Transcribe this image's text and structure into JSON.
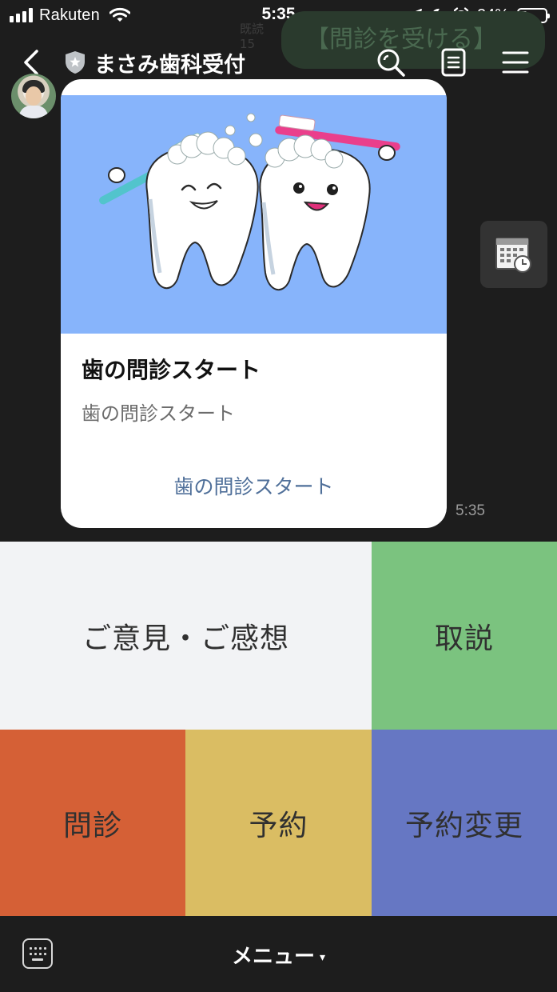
{
  "status_bar": {
    "carrier": "Rakuten",
    "time": "5:35",
    "battery_percent": "24%",
    "battery_level": 0.24,
    "signal_bars": 4
  },
  "background": {
    "sender_fragment": "既読\n15",
    "bubble_text": "【問診を受ける】"
  },
  "header": {
    "title": "まさみ歯科受付",
    "icons": [
      "back-chevron",
      "verified-shield",
      "search",
      "notes",
      "menu"
    ]
  },
  "message": {
    "card": {
      "title": "歯の問診スタート",
      "subtitle": "歯の問診スタート",
      "action_label": "歯の問診スタート",
      "image_bg_color": "#87b4fb"
    },
    "time": "5:35"
  },
  "side_button": {
    "icon": "calendar-clock"
  },
  "rich_menu": {
    "tiles": [
      {
        "label": "ご意見・ご感想",
        "color": "#f2f3f5"
      },
      {
        "label": "取説",
        "color": "#7bc37f"
      },
      {
        "label": "問診",
        "color": "#d56036"
      },
      {
        "label": "予約",
        "color": "#dabd63"
      },
      {
        "label": "予約変更",
        "color": "#6677c3"
      }
    ]
  },
  "bottom_bar": {
    "menu_label": "メニュー",
    "caret": "▾"
  },
  "colors": {
    "background": "#1d1d1d",
    "card": "#ffffff",
    "link": "#4f6f99"
  }
}
